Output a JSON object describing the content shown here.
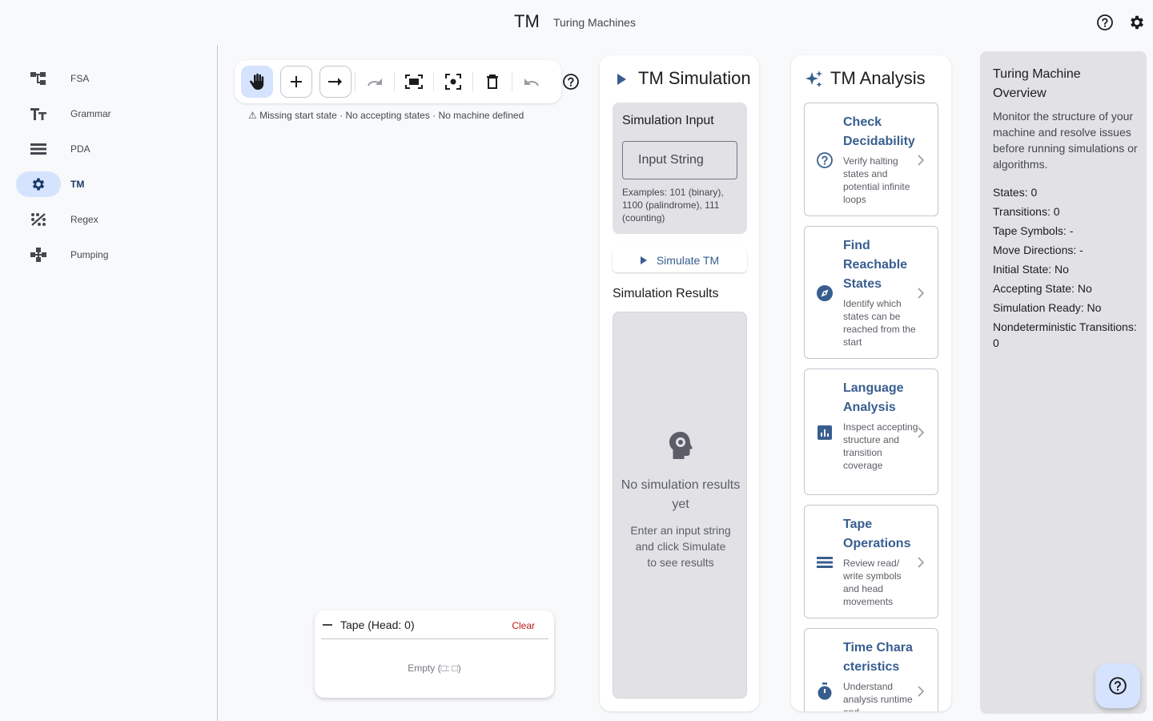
{
  "header": {
    "title": "TM",
    "subtitle": "Turing Machines",
    "help_icon": "help-circle-icon",
    "settings_icon": "gear-icon"
  },
  "sidebar": {
    "items": [
      {
        "label": "FSA",
        "icon": "fsa-tree-icon",
        "active": false
      },
      {
        "label": "Grammar",
        "icon": "text-fields-icon",
        "active": false
      },
      {
        "label": "PDA",
        "icon": "list-stack-icon",
        "active": false
      },
      {
        "label": "TM",
        "icon": "gear-icon",
        "active": true
      },
      {
        "label": "Regex",
        "icon": "regex-pattern-icon",
        "active": false
      },
      {
        "label": "Pumping",
        "icon": "pumping-graph-icon",
        "active": false
      }
    ]
  },
  "toolbar": {
    "tools": [
      "hand-tool",
      "add-state",
      "add-transition",
      "redo",
      "fit-view",
      "center-view",
      "delete",
      "undo",
      "help"
    ],
    "warning": "⚠ Missing start state · No accepting states · No machine defined"
  },
  "tape": {
    "title": "Tape (Head: 0)",
    "clear_label": "Clear",
    "empty_text": "Empty (□: □)"
  },
  "simulation": {
    "title": "TM Simulation",
    "input_section_title": "Simulation Input",
    "input_placeholder": "Input String",
    "input_value": "",
    "examples": "Examples: 101 (binary), 1100 (palindrome), 111 (counting)",
    "simulate_button": "Simulate TM",
    "results_title": "Simulation Results",
    "no_results_title": "No simulation results yet",
    "no_results_hint": "Enter an input string and click Simulate to see results"
  },
  "analysis": {
    "title": "TM Analysis",
    "cards": [
      {
        "title": "Check Decidability",
        "desc": "Verify halting states and potential infinite loops",
        "icon": "help-circle-icon"
      },
      {
        "title": "Find Reachable States",
        "desc": "Identify which states can be reached from the start",
        "icon": "compass-icon"
      },
      {
        "title": "Language Analysis",
        "desc": "Inspect accepting structure and transition coverage",
        "icon": "analytics-icon"
      },
      {
        "title": "Tape Operations",
        "desc": "Review read/ write symbols and head movements",
        "icon": "list-icon"
      },
      {
        "title": "Time Chara cteristics",
        "desc": "Understand analysis runtime and",
        "icon": "timer-icon"
      }
    ]
  },
  "overview": {
    "title": "Turing Machine Overview",
    "description": "Monitor the structure of your machine and resolve issues before running simulations or algorithms.",
    "stats": [
      "States: 0",
      "Transitions: 0",
      "Tape Symbols: -",
      "Move Directions: -",
      "Initial State: No",
      "Accepting State: No",
      "Simulation Ready: No",
      "Nondeterministic Transitions: 0"
    ]
  },
  "colors": {
    "accent": "#385e8f",
    "active_pill": "#d6e3ff",
    "error": "#ba1a1a",
    "surface_variant": "#e2e2e6"
  }
}
